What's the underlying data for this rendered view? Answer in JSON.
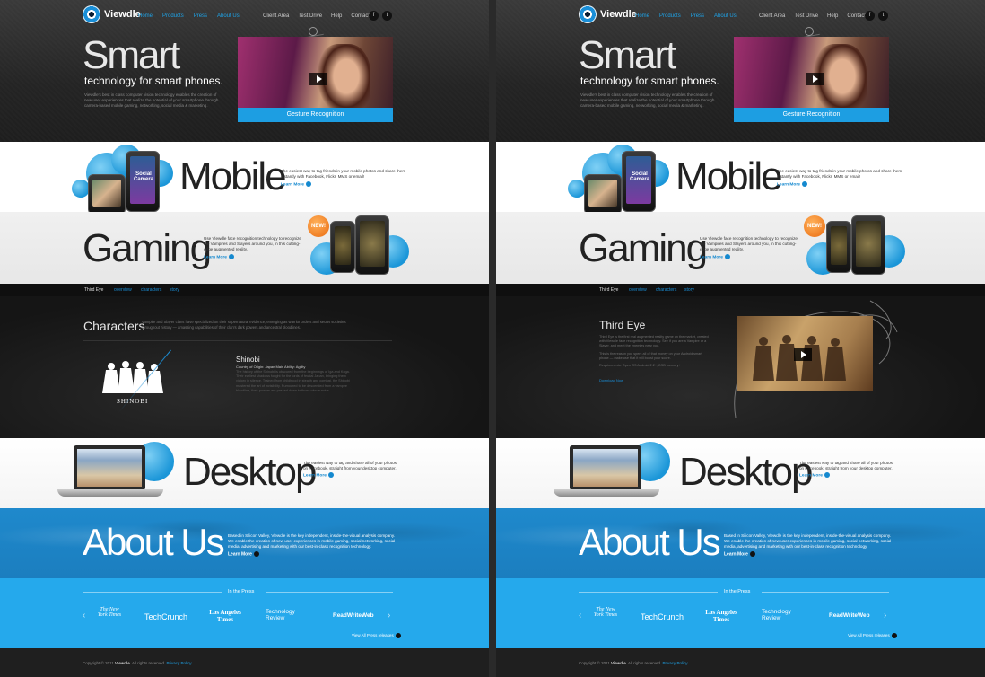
{
  "brand": {
    "name": "Viewdle"
  },
  "nav": {
    "primary": [
      "Home",
      "Products",
      "Press",
      "About Us"
    ],
    "secondary": [
      "Client Area",
      "Test Drive",
      "Help",
      "Contact"
    ],
    "social": [
      "facebook-icon",
      "twitter-icon"
    ]
  },
  "hero": {
    "title": "Smart",
    "tagline": "technology for smart phones.",
    "description": "Viewdle's best in class computer vision technology enables the creation of new user experiences that realize the potential of your smartphone through camera-based mobile gaming, networking, social media & marketing.",
    "video_caption": "Gesture Recognition"
  },
  "mobile": {
    "title": "Mobile",
    "phone_badge": "Social Camera",
    "text": "The easiest way to tag friends in your mobile photos and share them instantly with Facebook, Flickr, MMS or email!",
    "learn_more": "Learn More"
  },
  "gaming": {
    "title": "Gaming",
    "badge": "NEW!",
    "text": "Use Viewdle face recognition technology to reco­gnize the Vampires and Slayers around you, in this cutting-edge augmented reality.",
    "learn_more": "Learn More"
  },
  "subnav": [
    "Third Eye",
    "overview",
    "characters",
    "story"
  ],
  "characters": {
    "title": "Characters",
    "description": "Vampire and Slayer clans have specialized on their supernatural evidence, emerging as warrior orders and secret societies throughout history — amassing ca­pabilities of their clan's dark powers and ancestral bloodlines.",
    "logo_text": "SHINOBI",
    "name": "Shinobi",
    "meta": "Country of Origin: Japan   Main Ability: Agility",
    "bio": "The history of the Shinobi is obscured from the beginnings of Iga and Koga. Their earliest shadows fought for the lords of feudal Japan, bringing them victory in silence. Trained from childhood in stealth and combat, the Shinobi mastered the art of invisibility. Rumoured to be descended from a vampire bloodline, their powers are passed down to those who survive."
  },
  "third_eye": {
    "title": "Third Eye",
    "text_1": "Third Eye is the first real augmented reality game on the market, created with Viewdle face recognition technology. See if you are a Vampire or a Slayer, and meet the enemies near you.",
    "text_2": "This is the reason you spent all of that money on your Android smart phone — make use that it will boost your score.",
    "requirements": "Requirements: Open OS Android 2.2+, 2GB memory+",
    "download": "Download Now"
  },
  "desktop": {
    "title": "Desktop",
    "text": "The easiest way to tag and share all of your photos on Facebook, straight from your desktop computer.",
    "learn_more": "Learn More"
  },
  "about": {
    "title": "About Us",
    "text": "Based in Silicon Valley, Viewdle is the key independent, inside-the-visual analysis company. We enable the creation of new user experiences in mobile gaming, social networking, social media, advertising and marketing with our best-in-class recognition technology.",
    "learn_more": "Learn More"
  },
  "press": {
    "label": "In the Press",
    "logos": [
      "The New York Times",
      "TechCrunch",
      "Los Angeles Times",
      "Technology Review",
      "ReadWriteWeb"
    ],
    "view_all": "View All Press releases"
  },
  "footer": {
    "copyright": "Copyright © 2011",
    "brand": "Viewdle",
    "rights": ". All rights reserved.",
    "privacy": "Privacy Policy"
  },
  "colors": {
    "accent": "#1a8fd8",
    "about_bg": "#1f89cc",
    "press_bg": "#25a9ec",
    "badge": "#ea6b10"
  }
}
